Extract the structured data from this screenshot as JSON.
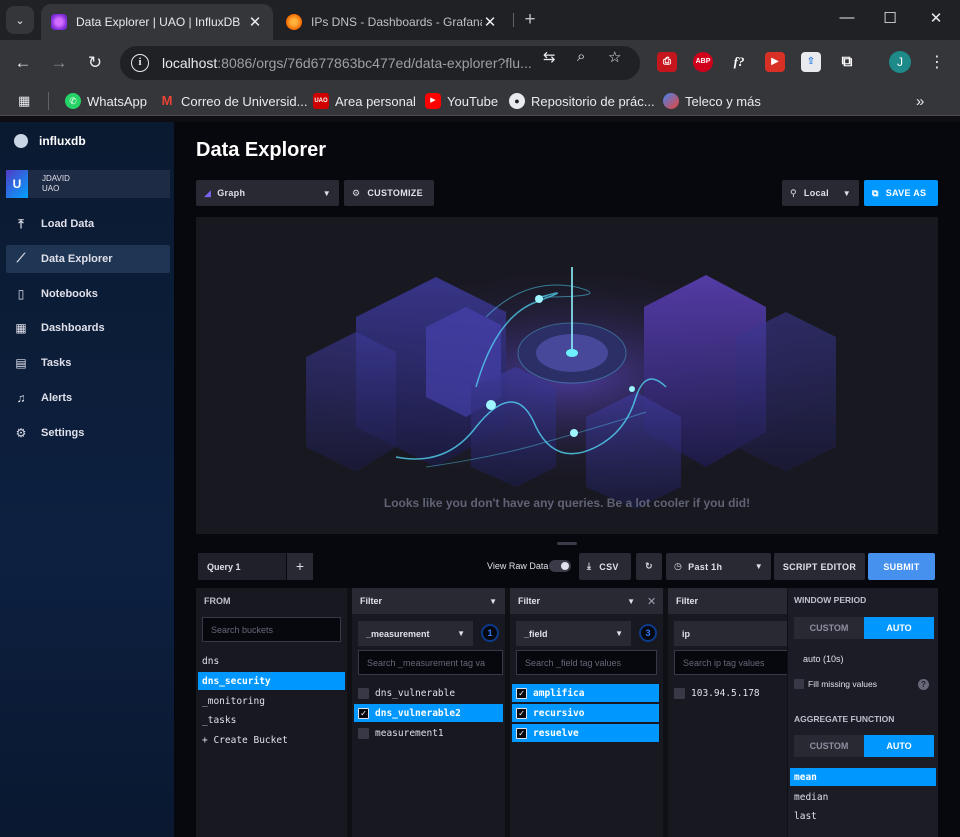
{
  "browser": {
    "tabs": [
      {
        "title": "Data Explorer | UAO | InfluxDB",
        "close": "✕"
      },
      {
        "title": "IPs DNS - Dashboards - Grafana",
        "close": "✕"
      }
    ],
    "url_host": "localhost",
    "url_rest": ":8086/orgs/76d677863bc477ed/data-explorer?flu...",
    "bookmarks": [
      {
        "label": "WhatsApp",
        "icon": "whatsapp-icon"
      },
      {
        "label": "Correo de Universid...",
        "icon": "gmail-icon"
      },
      {
        "label": "Area personal",
        "icon": "uao-icon"
      },
      {
        "label": "YouTube",
        "icon": "youtube-icon"
      },
      {
        "label": "Repositorio de prác...",
        "icon": "github-icon"
      },
      {
        "label": "Teleco y más",
        "icon": "teleco-icon"
      }
    ],
    "profile_initial": "J",
    "colors": {
      "chrome_dark": "#202124",
      "chrome_mid": "#35363a"
    }
  },
  "sidebar": {
    "logo": "influxdb",
    "user": {
      "initial": "U",
      "name": "JDAVID",
      "org": "UAO"
    },
    "items": [
      {
        "label": "Load Data",
        "icon": "upload-icon"
      },
      {
        "label": "Data Explorer",
        "icon": "graph-icon",
        "active": true
      },
      {
        "label": "Notebooks",
        "icon": "notebook-icon"
      },
      {
        "label": "Dashboards",
        "icon": "dashboard-icon"
      },
      {
        "label": "Tasks",
        "icon": "calendar-icon"
      },
      {
        "label": "Alerts",
        "icon": "bell-icon"
      },
      {
        "label": "Settings",
        "icon": "gear-icon"
      }
    ]
  },
  "main": {
    "title": "Data Explorer",
    "viz_type": "Graph",
    "customize": "CUSTOMIZE",
    "timezone": "Local",
    "save_as": "SAVE AS",
    "empty_message": "Looks like you don't have any queries. Be a lot cooler if you did!",
    "query_tab": "Query 1",
    "add_query": "+",
    "raw_data_label": "View Raw Data",
    "csv": "CSV",
    "time_range": "Past 1h",
    "script_editor": "SCRIPT EDITOR",
    "submit": "SUBMIT"
  },
  "builder": {
    "from": {
      "title": "FROM",
      "search_placeholder": "Search buckets",
      "buckets": [
        "dns",
        "dns_security",
        "_monitoring",
        "_tasks",
        "+ Create Bucket"
      ],
      "selected": "dns_security"
    },
    "filters": [
      {
        "title": "Filter",
        "key": "_measurement",
        "count": "1",
        "search_placeholder": "Search _measurement tag va",
        "values": [
          {
            "label": "dns_vulnerable",
            "checked": false
          },
          {
            "label": "dns_vulnerable2",
            "checked": true
          },
          {
            "label": "measurement1",
            "checked": false
          }
        ]
      },
      {
        "title": "Filter",
        "key": "_field",
        "count": "3",
        "search_placeholder": "Search _field tag values",
        "values": [
          {
            "label": "amplifica",
            "checked": true
          },
          {
            "label": "recursivo",
            "checked": true
          },
          {
            "label": "resuelve",
            "checked": true
          }
        ]
      },
      {
        "title": "Filter",
        "key": "ip",
        "search_placeholder": "Search ip tag values",
        "values": [
          {
            "label": "103.94.5.178",
            "checked": false
          }
        ]
      }
    ],
    "aggregate": {
      "window_title": "WINDOW PERIOD",
      "custom": "CUSTOM",
      "auto": "AUTO",
      "window_value": "auto (10s)",
      "fill_missing": "Fill missing values",
      "help": "?",
      "function_title": "AGGREGATE FUNCTION",
      "functions": [
        "mean",
        "median",
        "last"
      ],
      "selected_function": "mean"
    }
  },
  "colors": {
    "accent": "#0098ff",
    "submit": "#4591ed",
    "bg": "#07070e",
    "panel": "#181820"
  }
}
